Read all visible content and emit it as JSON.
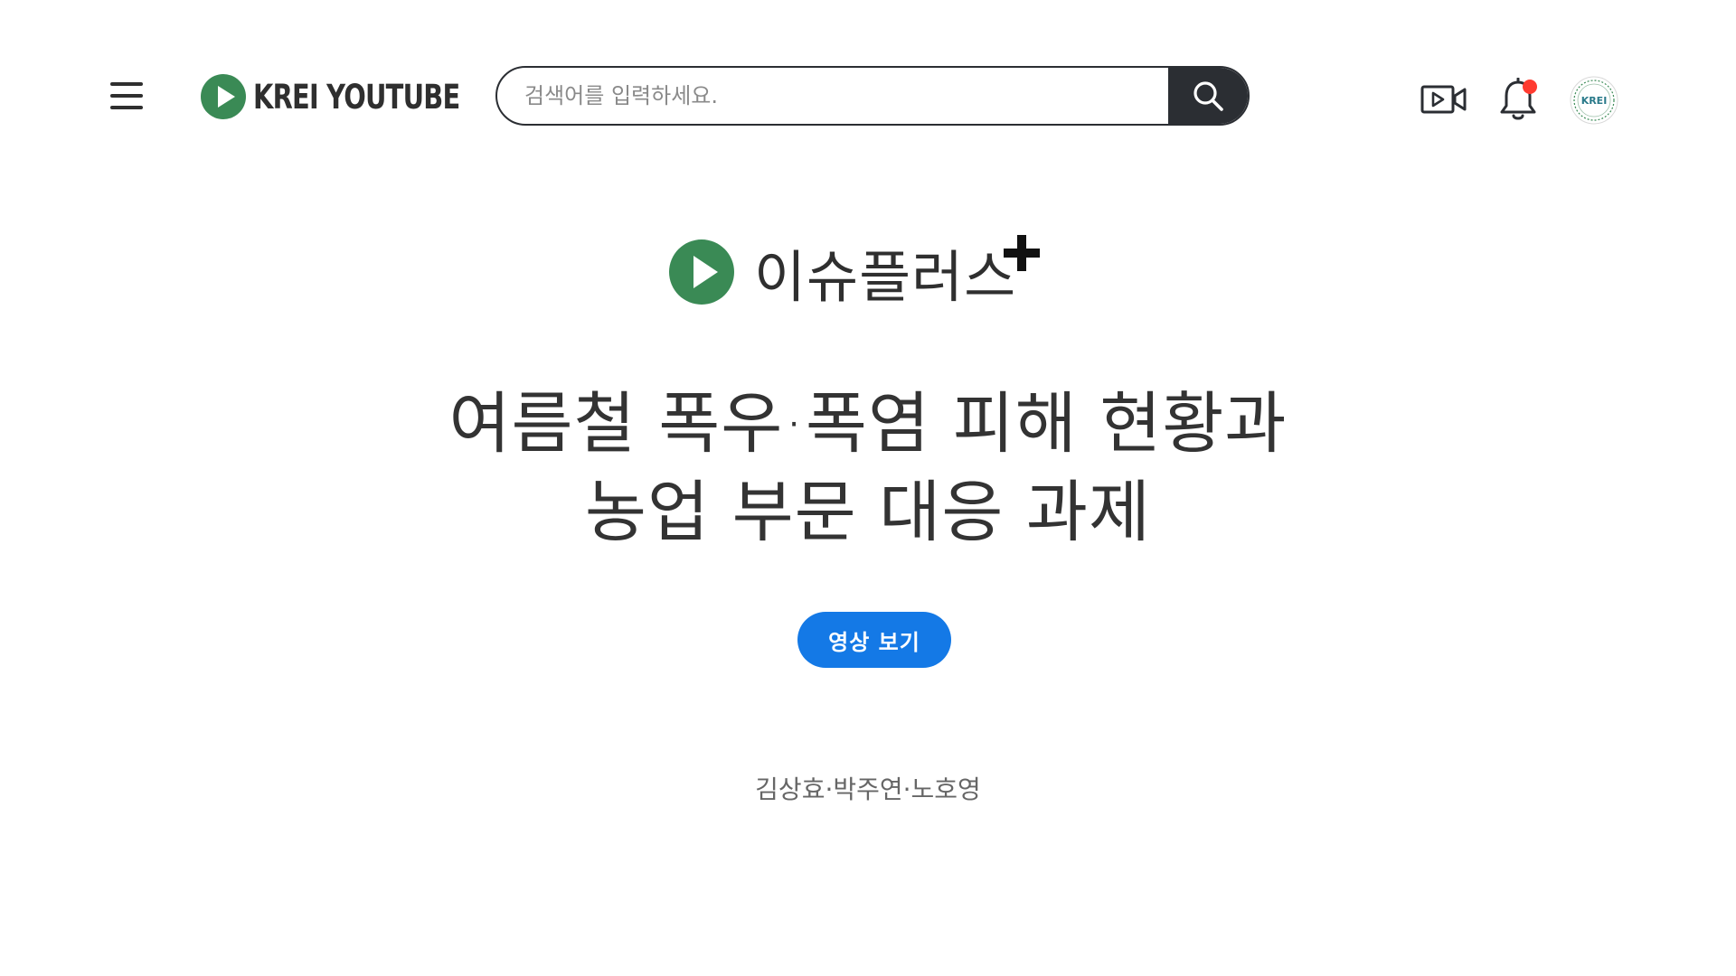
{
  "header": {
    "logo_text": "KREI YOUTUBE",
    "search": {
      "placeholder": "검색어를 입력하세요.",
      "value": ""
    },
    "icons": {
      "menu": "hamburger-menu-icon",
      "search": "search-icon",
      "upload": "video-camera-icon",
      "notifications": "bell-icon",
      "avatar": "krei-logo"
    },
    "avatar_text": "KREI"
  },
  "hero": {
    "brand": "이슈플러스",
    "title_lines": [
      "여름철 폭우·폭염 피해 현황과",
      "농업 부문 대응 과제"
    ],
    "watch_button_label": "영상 보기",
    "authors": "김상효·박주연·노호영"
  },
  "colors": {
    "brand_green": "#3a8a55",
    "search_button_bg": "#2b2e33",
    "watch_button_bg": "#1479e6",
    "notification_dot": "#ff3b30"
  }
}
